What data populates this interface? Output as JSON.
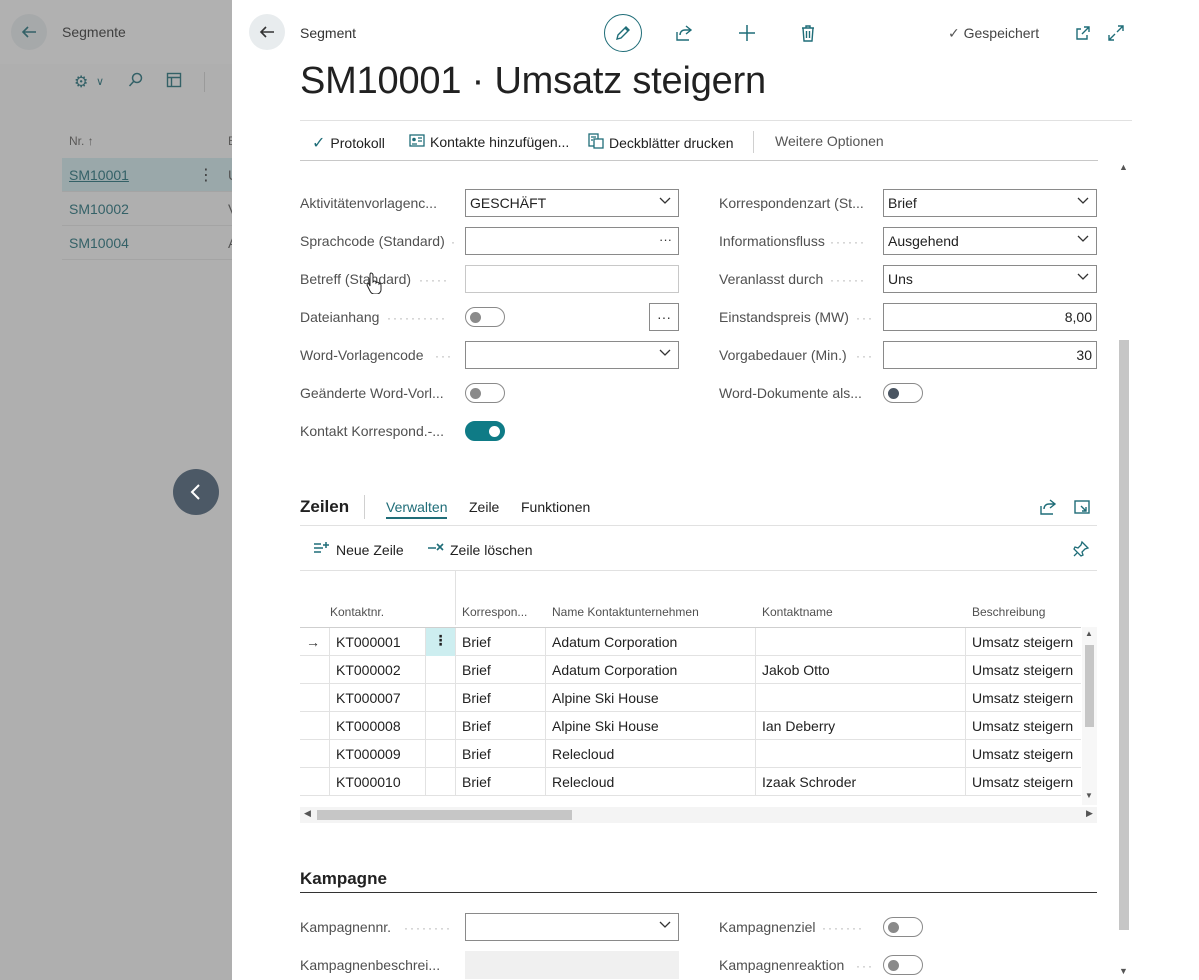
{
  "background_page": {
    "title": "Segmente",
    "col_no": "Nr. ↑",
    "col_desc_trunc": "B",
    "rows": [
      {
        "no": "SM10001",
        "desc_trunc": "U"
      },
      {
        "no": "SM10002",
        "desc_trunc": "V"
      },
      {
        "no": "SM10004",
        "desc_trunc": "A"
      }
    ]
  },
  "card": {
    "breadcrumb": "Segment",
    "saved_status": "Gespeichert",
    "title": "SM10001 · Umsatz steigern",
    "actions": {
      "protocol": "Protokoll",
      "add_contacts": "Kontakte hinzufügen...",
      "print_cover": "Deckblätter drucken",
      "more_options": "Weitere Optionen"
    }
  },
  "fields_left": [
    {
      "label": "Aktivitätenvorlagenc...",
      "value": "GESCHÄFT",
      "kind": "dropdown"
    },
    {
      "label": "Sprachcode (Standard)",
      "value": "",
      "kind": "lookup"
    },
    {
      "label": "Betreff (Standard)",
      "value": "",
      "kind": "text-readonly"
    },
    {
      "label": "Dateianhang",
      "value": "off",
      "kind": "toggle"
    },
    {
      "label": "Word-Vorlagencode",
      "value": "",
      "kind": "dropdown"
    },
    {
      "label": "Geänderte Word-Vorl...",
      "value": "off",
      "kind": "toggle"
    },
    {
      "label": "Kontakt Korrespond.-...",
      "value": "on",
      "kind": "toggle"
    }
  ],
  "fields_right": [
    {
      "label": "Korrespondenzart (St...",
      "value": "Brief",
      "kind": "dropdown"
    },
    {
      "label": "Informationsfluss",
      "value": "Ausgehend",
      "kind": "dropdown"
    },
    {
      "label": "Veranlasst durch",
      "value": "Uns",
      "kind": "dropdown"
    },
    {
      "label": "Einstandspreis (MW)",
      "value": "8,00",
      "kind": "number"
    },
    {
      "label": "Vorgabedauer (Min.)",
      "value": "30",
      "kind": "number"
    },
    {
      "label": "Word-Dokumente als...",
      "value": "off",
      "kind": "toggle"
    }
  ],
  "lines": {
    "title": "Zeilen",
    "tabs": [
      "Verwalten",
      "Zeile",
      "Funktionen"
    ],
    "active_tab": "Verwalten",
    "new_line": "Neue Zeile",
    "delete_line": "Zeile löschen",
    "columns": [
      "Kontaktnr.",
      "Korrespon...",
      "Name Kontaktunternehmen",
      "Kontaktname",
      "Beschreibung"
    ],
    "rows": [
      {
        "contact_no": "KT000001",
        "corr": "Brief",
        "company": "Adatum Corporation",
        "name": "",
        "desc": "Umsatz steigern"
      },
      {
        "contact_no": "KT000002",
        "corr": "Brief",
        "company": "Adatum Corporation",
        "name": "Jakob Otto",
        "desc": "Umsatz steigern"
      },
      {
        "contact_no": "KT000007",
        "corr": "Brief",
        "company": "Alpine Ski House",
        "name": "",
        "desc": "Umsatz steigern"
      },
      {
        "contact_no": "KT000008",
        "corr": "Brief",
        "company": "Alpine Ski House",
        "name": "Ian Deberry",
        "desc": "Umsatz steigern"
      },
      {
        "contact_no": "KT000009",
        "corr": "Brief",
        "company": "Relecloud",
        "name": "",
        "desc": "Umsatz steigern"
      },
      {
        "contact_no": "KT000010",
        "corr": "Brief",
        "company": "Relecloud",
        "name": "Izaak Schroder",
        "desc": "Umsatz steigern"
      }
    ]
  },
  "campaign": {
    "title": "Kampagne",
    "no_label": "Kampagnennr.",
    "desc_label": "Kampagnenbeschrei...",
    "target_label": "Kampagnenziel",
    "response_label": "Kampagnenreaktion"
  },
  "colors": {
    "accent": "#1f6d78",
    "toggle_on": "#0f7b86",
    "selected_row": "#cfe7ea"
  }
}
